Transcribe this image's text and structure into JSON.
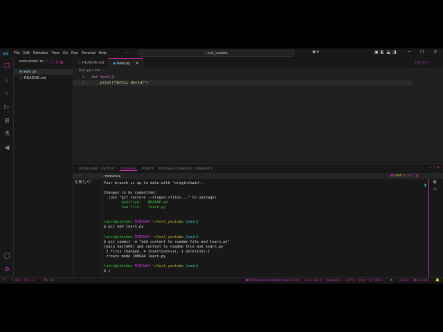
{
  "titlebar": {
    "menu": [
      "File",
      "Edit",
      "Selection",
      "View",
      "Go",
      "Run",
      "Terminal",
      "Help"
    ],
    "search": "test_youtube"
  },
  "sidebar": {
    "title": "EXPLORER: TE...",
    "files": [
      "learn.py",
      "README.md"
    ]
  },
  "editor": {
    "tabs": [
      "README.md",
      "learn.py"
    ],
    "breadcrumb": [
      "learn.py",
      ">",
      "test"
    ],
    "lines": [
      {
        "n": "1",
        "code": "def test():"
      },
      {
        "n": "2",
        "code": "    print(\"Hello, World!\")"
      }
    ]
  },
  "panel": {
    "tabs": [
      "PROBLEMS",
      "OUTPUT",
      "TERMINAL",
      "PORTS",
      "POSTMAN CONSOLE",
      "COMMENTS"
    ],
    "terminal_title": "TERMINAL",
    "shell": "bash",
    "lines": [
      {
        "t": "Your branch is up to date with 'origin/main'.",
        "c": ""
      },
      {
        "t": "",
        "c": ""
      },
      {
        "t": "Changes to be committed:",
        "c": ""
      },
      {
        "t": "  (use \"git restore --staged <file>...\" to unstage)",
        "c": ""
      },
      {
        "t": "        modified:   README.md",
        "c": "g"
      },
      {
        "t": "        new file:   learn.py",
        "c": "g"
      },
      {
        "t": "",
        "c": ""
      },
      {
        "t": "",
        "c": ""
      },
      {
        "t": "laksh@Lakshmi MINGW64 ~/test_youtube (main)",
        "c": "p"
      },
      {
        "t": "$ git add learn.py",
        "c": ""
      },
      {
        "t": "",
        "c": ""
      },
      {
        "t": "laksh@Lakshmi MINGW64 ~/test_youtube (main)",
        "c": "p"
      },
      {
        "t": "$ git commit -m \"add content to readme file and learn.py\"",
        "c": ""
      },
      {
        "t": "[main 3a1fd06] add content to readme file and learn.py",
        "c": ""
      },
      {
        "t": " 2 files changed, 4 insertions(+), 1 deletion(-)",
        "c": ""
      },
      {
        "t": " create mode 100644 learn.py",
        "c": ""
      },
      {
        "t": "",
        "c": ""
      },
      {
        "t": "laksh@Lakshmi MINGW64 ~/test_youtube (main)",
        "c": "p"
      },
      {
        "t": "$ ",
        "c": ""
      }
    ]
  },
  "status": {
    "branch": "main",
    "sync": "0↓ 1↑",
    "problems": "⊗0 ⚠0",
    "user": "lakshmiprasannamalempati (now)",
    "position": "Ln 2, Col 27",
    "spaces": "Spaces: 4",
    "encoding": "UTF-8",
    "eol": "CRLF",
    "language": "Python",
    "version": "3.10.4",
    "golive": "Go Live"
  },
  "colors": {
    "accent": "#c030b0",
    "bg": "#181818"
  }
}
